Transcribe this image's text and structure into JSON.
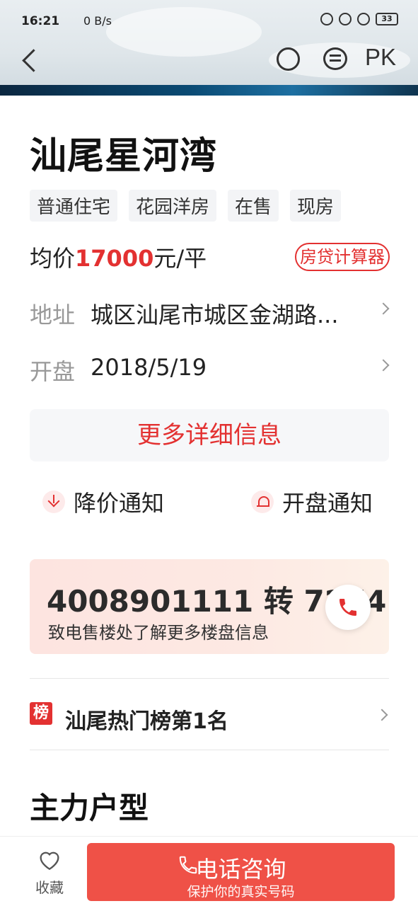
{
  "status": {
    "time": "16:21",
    "network": "0 B/s",
    "battery": "33"
  },
  "topbar": {
    "pk_label": "PK"
  },
  "property": {
    "name": "汕尾星河湾",
    "tags": [
      "普通住宅",
      "花园洋房",
      "在售",
      "现房"
    ],
    "price_prefix": "均价",
    "price_value": "17000",
    "price_unit": "元/平",
    "calc_label": "房贷计算器",
    "address_label": "地址",
    "address_value": "城区汕尾市城区金湖路...",
    "open_label": "开盘",
    "open_value": "2018/5/19",
    "more_info_label": "更多详细信息"
  },
  "notifications": {
    "price_drop": "降价通知",
    "opening": "开盘通知"
  },
  "contact": {
    "phone": "4008901111 转 7274",
    "desc": "致电售楼处了解更多楼盘信息"
  },
  "ranking": {
    "badge": "榜",
    "text": "汕尾热门榜第1名"
  },
  "section": {
    "title": "主力户型"
  },
  "bottom": {
    "fav_label": "收藏",
    "call_label": "电话咨询",
    "call_sub": "保护你的真实号码"
  },
  "colors": {
    "accent": "#e33131",
    "call_button": "#ef5147"
  }
}
